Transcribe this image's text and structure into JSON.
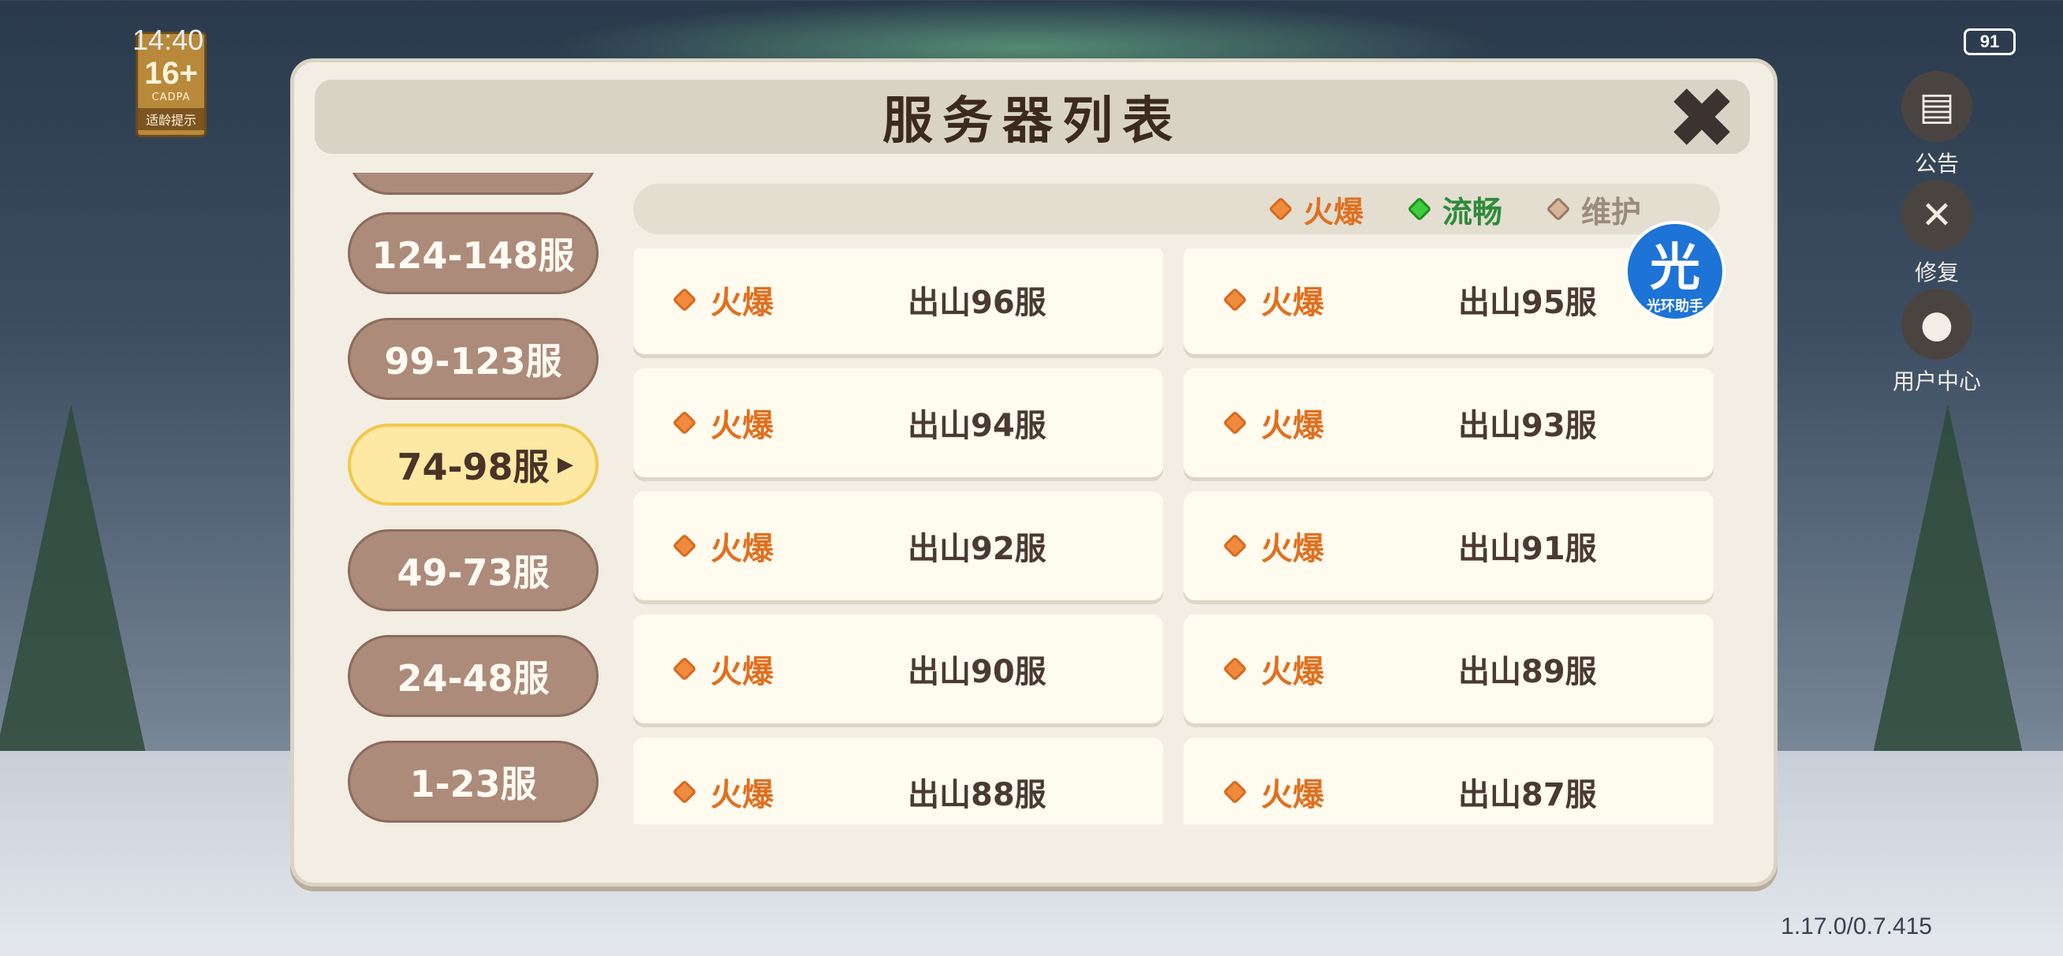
{
  "status_bar": {
    "time": "14:40",
    "battery": "91"
  },
  "age_badge": {
    "age": "16+",
    "org": "CADPA",
    "tip": "适龄提示"
  },
  "side_buttons": [
    {
      "icon": "notice-icon",
      "label": "公告"
    },
    {
      "icon": "wrench-icon",
      "label": "修复"
    },
    {
      "icon": "user-icon",
      "label": "用户中心"
    }
  ],
  "dialog": {
    "title": "服务器列表",
    "legend": [
      {
        "status": "hot",
        "label": "火爆",
        "color": "#E07020"
      },
      {
        "status": "smooth",
        "label": "流畅",
        "color": "#2E8B3A"
      },
      {
        "status": "maintenance",
        "label": "维护",
        "color": "#9A8A80"
      }
    ],
    "ranges": [
      {
        "label": "124-148服",
        "active": false
      },
      {
        "label": "99-123服",
        "active": false
      },
      {
        "label": "74-98服",
        "active": true
      },
      {
        "label": "49-73服",
        "active": false
      },
      {
        "label": "24-48服",
        "active": false
      },
      {
        "label": "1-23服",
        "active": false
      }
    ],
    "servers": [
      {
        "status": "火爆",
        "name": "出山96服"
      },
      {
        "status": "火爆",
        "name": "出山95服"
      },
      {
        "status": "火爆",
        "name": "出山94服"
      },
      {
        "status": "火爆",
        "name": "出山93服"
      },
      {
        "status": "火爆",
        "name": "出山92服"
      },
      {
        "status": "火爆",
        "name": "出山91服"
      },
      {
        "status": "火爆",
        "name": "出山90服"
      },
      {
        "status": "火爆",
        "name": "出山89服"
      },
      {
        "status": "火爆",
        "name": "出山88服"
      },
      {
        "status": "火爆",
        "name": "出山87服"
      }
    ]
  },
  "assistant": {
    "glyph": "光",
    "label": "光环助手"
  },
  "version": "1.17.0/0.7.415"
}
